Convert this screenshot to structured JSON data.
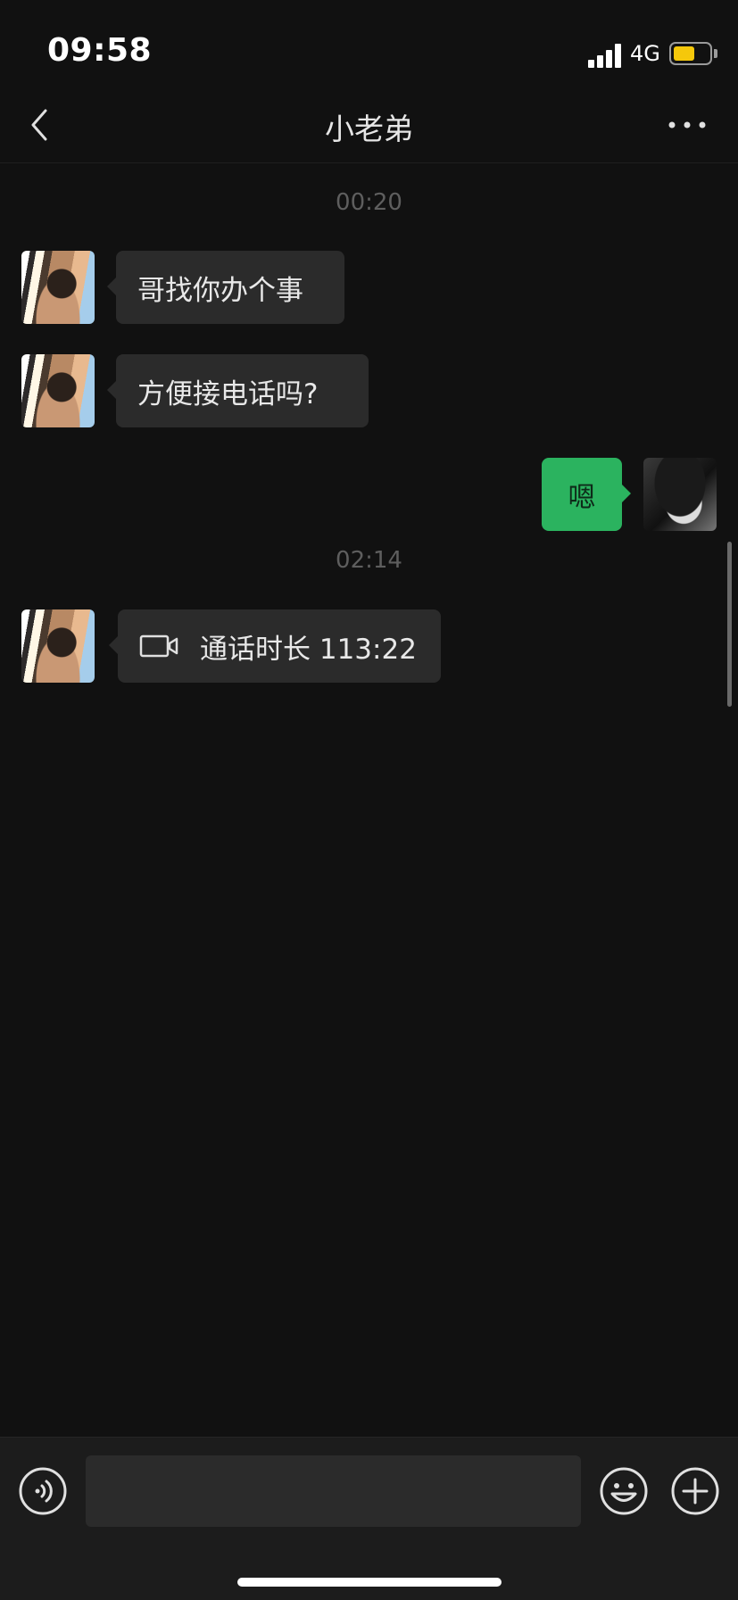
{
  "status": {
    "time": "09:58",
    "network": "4G",
    "battery_level": 0.6,
    "battery_color": "#f5c80b"
  },
  "header": {
    "title": "小老弟",
    "back_icon": "chevron-left-icon",
    "more_icon": "more-dots-icon"
  },
  "messages": {
    "time1": "00:20",
    "m1": "哥找你办个事",
    "m2": "方便接电话吗?",
    "m3": "嗯",
    "time2": "02:14",
    "call": "通话时长 113:22"
  },
  "input": {
    "placeholder": "",
    "voice_icon": "voice-icon",
    "emoji_icon": "emoji-icon",
    "plus_icon": "plus-icon"
  },
  "colors": {
    "background": "#111111",
    "bubble_in": "#2b2b2b",
    "bubble_out": "#2bb35f"
  }
}
